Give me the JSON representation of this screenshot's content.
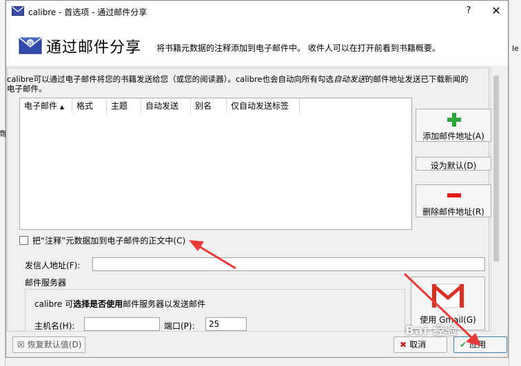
{
  "window": {
    "title": "calibre - 首选项 - 通过邮件分享",
    "help_glyph": "?",
    "close_glyph": "✕"
  },
  "header": {
    "title": "通过邮件分享",
    "subtitle": "将书籍元数据的注释添加到电子邮件中。 收件人可以在打开前看到书籍概要。"
  },
  "description": {
    "part1": "calibre可以通过电子邮件将您的书籍发送给您（或您的阅读器）。calibre也会自动向所有勾选",
    "italic": "自动发送",
    "part2": "的邮件地址发送已下载新闻的电子邮件。"
  },
  "table": {
    "columns": [
      "电子邮件",
      "格式",
      "主题",
      "自动发送",
      "别名",
      "仅自动发送标签"
    ],
    "sort_glyph": "▲",
    "rows": []
  },
  "buttons": {
    "add": "添加邮件地址(A)",
    "set_default": "设为默认(D)",
    "delete": "删除邮件地址(R)",
    "gmail": "使用 Gmail(G)",
    "restore": "恢复默认值(D)",
    "cancel": "取消",
    "apply": "应用"
  },
  "checkbox": {
    "label": "把“注释”元数据加到电子邮件的正文中(C)",
    "checked": false
  },
  "sender": {
    "label": "发信人地址(F):",
    "value": ""
  },
  "server": {
    "group_label": "邮件服务器",
    "desc_prefix": "calibre 可",
    "desc_bold": "选择是否使用",
    "desc_suffix": "邮件服务器以发送邮件",
    "host_label": "主机名(H):",
    "host_value": "",
    "port_label": "端口(P):",
    "port_value": "25"
  },
  "background": {
    "right_fragment": "le",
    "left_fragment": "商"
  },
  "watermark": "Bai 经验",
  "colors": {
    "arrow": "#e83838",
    "accent": "#3c7fb1",
    "add_green": "#2ea43a",
    "delete_red": "#e21a1a"
  }
}
